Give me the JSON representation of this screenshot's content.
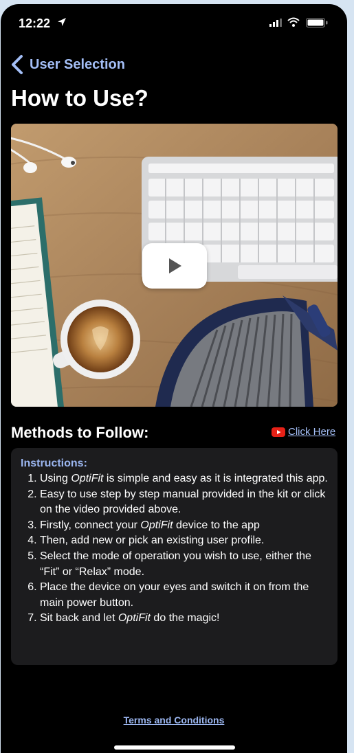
{
  "status_bar": {
    "time": "12:22",
    "icons": [
      "location-arrow-icon",
      "signal-icon",
      "wifi-icon",
      "battery-icon"
    ]
  },
  "nav": {
    "back_label": "User Selection"
  },
  "page": {
    "title": "How to Use?"
  },
  "video": {
    "play_icon": "play-icon"
  },
  "methods": {
    "title": "Methods to Follow:",
    "link_label": "Click Here",
    "link_icon": "youtube-icon"
  },
  "instructions": {
    "heading": "Instructions:",
    "items": [
      {
        "pre": "Using ",
        "em": "OptiFit",
        "post": " is simple and easy as it is integrated this app."
      },
      {
        "pre": "Easy to use step by step manual provided in the kit or click on the video provided above.",
        "em": "",
        "post": ""
      },
      {
        "pre": "Firstly, connect your ",
        "em": "OptiFit",
        "post": " device to the app"
      },
      {
        "pre": "Then, add new or pick an existing user profile.",
        "em": "",
        "post": ""
      },
      {
        "pre": "Select the mode of operation you wish to use, either the “Fit” or “Relax” mode.",
        "em": "",
        "post": ""
      },
      {
        "pre": "Place the device on your eyes and switch it on from the main power button.",
        "em": "",
        "post": ""
      },
      {
        "pre": "Sit back and let ",
        "em": "OptiFit",
        "post": " do the magic!"
      }
    ]
  },
  "footer": {
    "terms_label": "Terms and Conditions"
  },
  "colors": {
    "background": "#000000",
    "accent": "#a4bff7",
    "card": "#1c1c1e",
    "youtube_red": "#e62117"
  }
}
